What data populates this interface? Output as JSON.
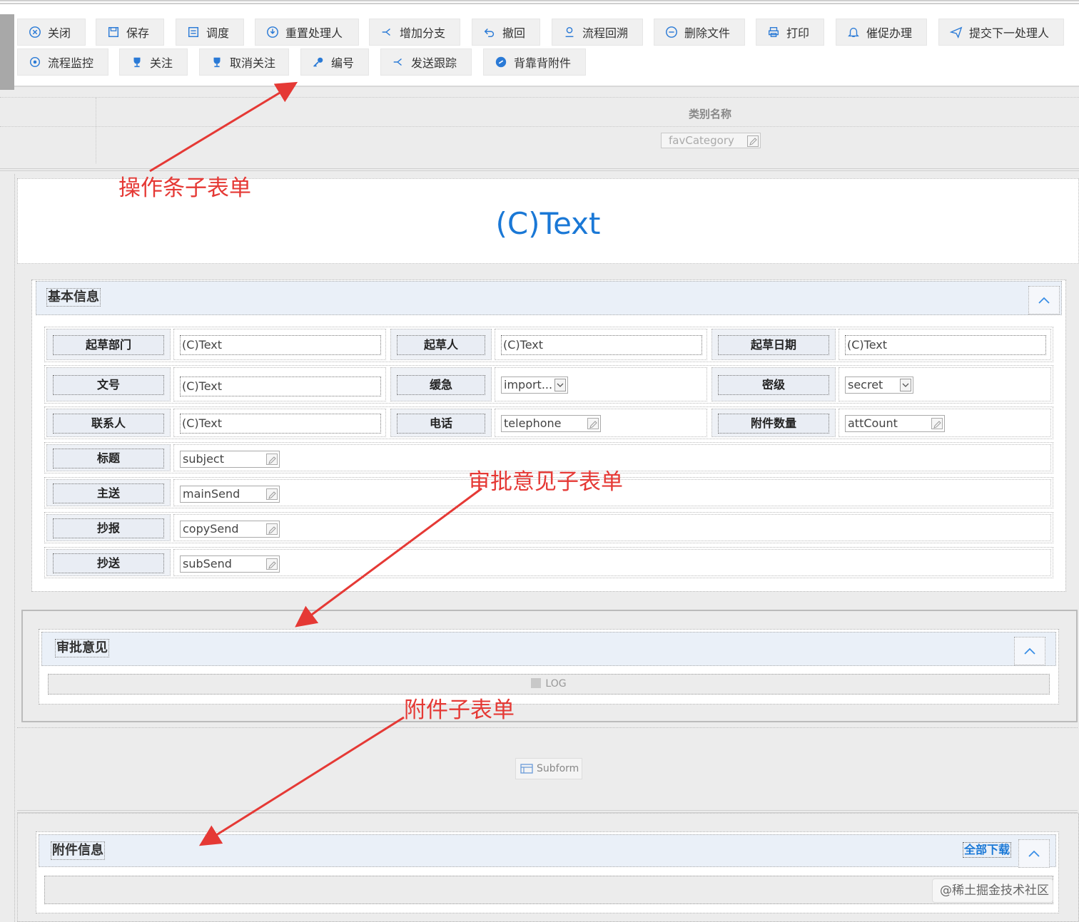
{
  "toolbar": {
    "row1": [
      {
        "label": "关闭",
        "icon": "close-circle-icon"
      },
      {
        "label": "保存",
        "icon": "save-icon"
      },
      {
        "label": "调度",
        "icon": "schedule-icon"
      },
      {
        "label": "重置处理人",
        "icon": "reset-handler-icon"
      },
      {
        "label": "增加分支",
        "icon": "branch-icon"
      },
      {
        "label": "撤回",
        "icon": "undo-icon"
      },
      {
        "label": "流程回溯",
        "icon": "trace-back-icon"
      },
      {
        "label": "删除文件",
        "icon": "minus-circle-icon"
      },
      {
        "label": "打印",
        "icon": "printer-icon"
      },
      {
        "label": "催促办理",
        "icon": "bell-icon"
      },
      {
        "label": "提交下一处理人",
        "icon": "send-icon"
      }
    ],
    "row2": [
      {
        "label": "流程监控",
        "icon": "monitor-icon"
      },
      {
        "label": "关注",
        "icon": "trophy-icon"
      },
      {
        "label": "取消关注",
        "icon": "trophy-icon"
      },
      {
        "label": "编号",
        "icon": "key-icon"
      },
      {
        "label": "发送跟踪",
        "icon": "branch-icon"
      },
      {
        "label": "背靠背附件",
        "icon": "link-icon"
      }
    ]
  },
  "category": {
    "title": "类别名称",
    "field_value": "favCategory"
  },
  "form_title": "(C)Text",
  "basic_info": {
    "title": "基本信息",
    "labels": {
      "draft_dept": "起草部门",
      "drafter": "起草人",
      "draft_date": "起草日期",
      "doc_no": "文号",
      "urgency": "缓急",
      "secret_level": "密级",
      "contact": "联系人",
      "phone": "电话",
      "att_count": "附件数量",
      "subject": "标题",
      "main_send": "主送",
      "copy_report": "抄报",
      "copy_send": "抄送"
    },
    "values": {
      "draft_dept": "(C)Text",
      "drafter": "(C)Text",
      "draft_date": "(C)Text",
      "doc_no": "(C)Text",
      "urgency": "import...",
      "secret_level": "secret",
      "contact": "(C)Text",
      "phone": "telephone",
      "att_count": "attCount",
      "subject": "subject",
      "main_send": "mainSend",
      "copy_report": "copySend",
      "copy_send": "subSend"
    }
  },
  "approval": {
    "title": "审批意见",
    "log_label": "LOG"
  },
  "subform": {
    "label": "Subform"
  },
  "attachment": {
    "title": "附件信息",
    "download_all": "全部下载"
  },
  "annotations": {
    "toolbar_note": "操作条子表单",
    "approval_note": "审批意见子表单",
    "attachment_note": "附件子表单"
  },
  "watermark": "@稀土掘金技术社区",
  "colors": {
    "accent": "#1a78d6",
    "annotation": "#e53935",
    "panel_header": "#eaf0f8"
  }
}
